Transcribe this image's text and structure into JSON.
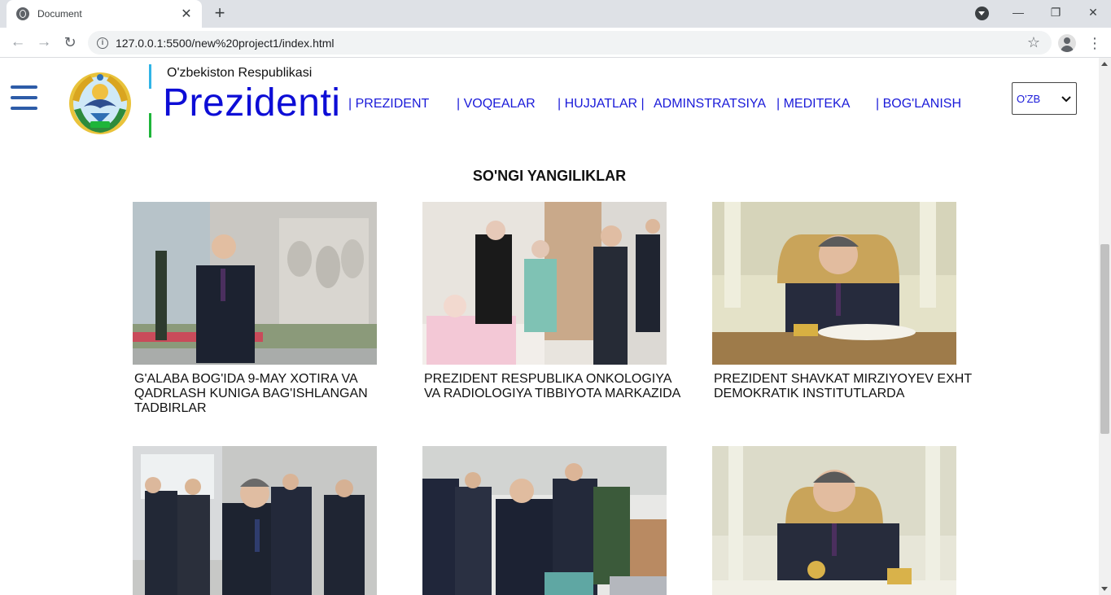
{
  "browser": {
    "tab_title": "Document",
    "url": "127.0.0.1:5500/new%20project1/index.html",
    "new_tab": "+",
    "close_tab": "✕",
    "back": "←",
    "forward": "→",
    "reload": "↻",
    "star": "☆",
    "menu": "⋮",
    "minimize": "—",
    "maximize": "❐",
    "close_window": "✕"
  },
  "header": {
    "subtitle": "O'zbekiston Respublikasi",
    "title": "Prezidenti",
    "flag_colors": [
      "#30b4e6",
      "#ffffff",
      "#1eb53a"
    ],
    "nav": [
      {
        "label": "| PREZIDENT"
      },
      {
        "label": "| VOQEALAR"
      },
      {
        "label": "| HUJJATLAR |"
      },
      {
        "label": "ADMINSTRATSIYA"
      },
      {
        "label": "| MEDITEKA"
      },
      {
        "label": "| BOG'LANISH"
      }
    ],
    "language": "O'ZB"
  },
  "news": {
    "section_title": "SO'NGI YANGILIKLAR",
    "items": [
      {
        "caption": "G'ALABA BOG'IDA 9-MAY XOTIRA VA QADRLASH KUNIGA BAG'ISHLANGAN TADBIRLAR"
      },
      {
        "caption": "PREZIDENT RESPUBLIKA ONKOLOGIYA VA RADIOLOGIYA TIBBIYOTA MARKAZIDA"
      },
      {
        "caption": "PREZIDENT SHAVKAT MIRZIYOYEV EXHT DEMOKRATIK INSTITUTLARDA"
      },
      {
        "caption": ""
      },
      {
        "caption": ""
      },
      {
        "caption": ""
      }
    ]
  },
  "colors": {
    "brand_blue": "#0d0dd6",
    "nav_blue": "#1a1ad9",
    "hamburger": "#2d5ca8"
  }
}
